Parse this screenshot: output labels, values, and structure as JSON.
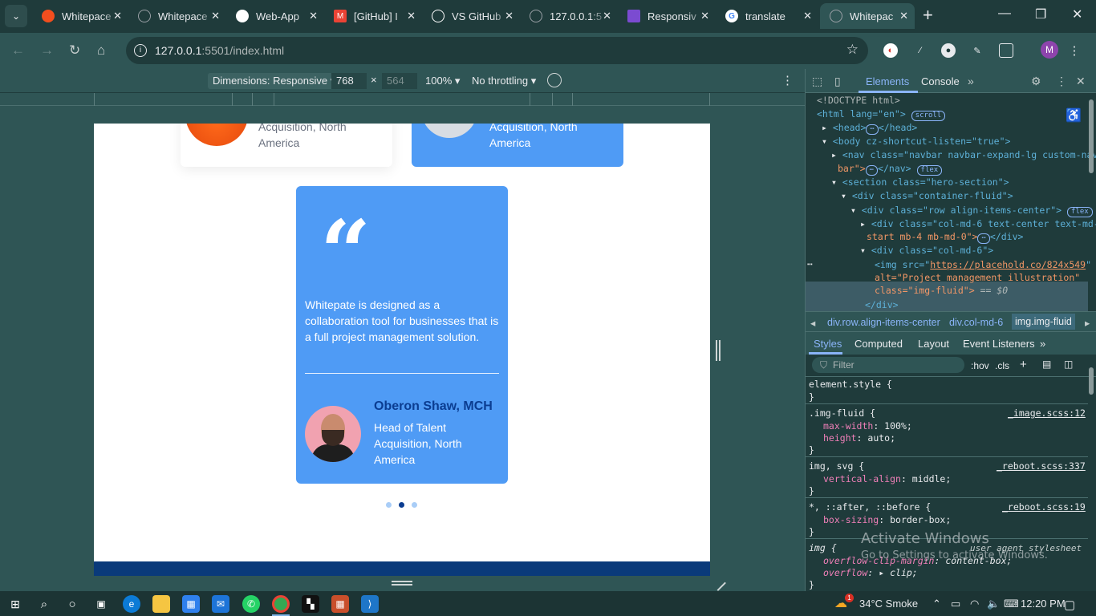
{
  "browser": {
    "tabs": [
      {
        "title": "Whitepace",
        "favicon": "figma-icon",
        "color": "#f24e1e"
      },
      {
        "title": "Whitepace",
        "favicon": "globe-icon",
        "color": "#9aa0a6"
      },
      {
        "title": "Web-App",
        "favicon": "github-icon",
        "color": "#ffffff"
      },
      {
        "title": "[GitHub] I",
        "favicon": "gmail-icon",
        "color": "#ea4335"
      },
      {
        "title": "VS GitHub",
        "favicon": "openai-icon",
        "color": "#ffffff"
      },
      {
        "title": "127.0.0.1:5",
        "favicon": "globe-icon",
        "color": "#9aa0a6"
      },
      {
        "title": "Responsiv",
        "favicon": "forms-icon",
        "color": "#7b4bd1"
      },
      {
        "title": "translate",
        "favicon": "google-icon",
        "color": "#4285f4"
      },
      {
        "title": "Whitepac",
        "favicon": "globe-icon",
        "color": "#9aa0a6",
        "active": true
      }
    ],
    "url_host": "127.0.0.1",
    "url_path": ":5501/index.html",
    "profile_initial": "M"
  },
  "device_toolbar": {
    "dimensions_label": "Dimensions: Responsive",
    "width": "768",
    "times": "×",
    "height": "564",
    "zoom": "100%",
    "throttling": "No throttling"
  },
  "page": {
    "card_top_left": {
      "role": "Acquisition, North America"
    },
    "card_top_right": {
      "role": "Acquisition, North America"
    },
    "testimonial": {
      "quote": "Whitepate is designed as a collaboration tool for businesses that is a full project management solution.",
      "name": "Oberon Shaw, MCH",
      "role": "Head of Talent Acquisition, North America"
    },
    "carousel_dots": 3,
    "active_dot": 1
  },
  "devtools": {
    "tabs": [
      "Elements",
      "Console"
    ],
    "active_tab": "Elements",
    "dom": {
      "doctype": "<!DOCTYPE html>",
      "html_open": "<html lang=\"en\">",
      "html_badge": "scroll",
      "head": "<head>",
      "head_close": "</head>",
      "body_open": "<body cz-shortcut-listen=\"true\">",
      "nav_line1": "<nav class=\"navbar navbar-expand-lg custom-nav",
      "nav_line2": "bar\">",
      "nav_close": "</nav>",
      "flex_badge": "flex",
      "section": "<section class=\"hero-section\">",
      "container": "<div class=\"container-fluid\">",
      "row": "<div class=\"row align-items-center\">",
      "col1_line1": "<div class=\"col-md-6 text-center text-md-",
      "col1_line2": "start mb-4 mb-md-0\">",
      "div_close": "</div>",
      "col2": "<div class=\"col-md-6\">",
      "img_src_label": "<img src=\"",
      "img_src": "https://placehold.co/824x549",
      "img_alt": "alt=\"Project management illustration\"",
      "img_class": "class=\"img-fluid\">",
      "img_eq": "== $0",
      "close_div": "</div>"
    },
    "breadcrumbs": [
      "div.row.align-items-center",
      "div.col-md-6",
      "img.img-fluid"
    ],
    "style_tabs": [
      "Styles",
      "Computed",
      "Layout",
      "Event Listeners"
    ],
    "filter_placeholder": "Filter",
    "hov": ":hov",
    "cls": ".cls",
    "rules": {
      "element_style": "element.style {",
      "brace_close": "}",
      "img_fluid_sel": ".img-fluid {",
      "img_fluid_src": "_image.scss:12",
      "max_width_prop": "max-width",
      "max_width_val": "100%;",
      "height_prop": "height",
      "height_val": "auto;",
      "img_svg_sel": "img, svg {",
      "img_svg_src": "_reboot.scss:337",
      "valign_prop": "vertical-align",
      "valign_val": "middle;",
      "universal_sel": "*, ::after, ::before {",
      "universal_src": "_reboot.scss:19",
      "boxsizing_prop": "box-sizing",
      "boxsizing_val": "border-box;",
      "img_sel": "img {",
      "img_src_note": "user agent stylesheet",
      "overflow_clip_prop": "overflow-clip-margin",
      "overflow_clip_val": "content-box;",
      "overflow_prop": "overflow",
      "overflow_val": "clip;"
    },
    "watermark_title": "Activate Windows",
    "watermark_sub": "Go to Settings to activate Windows."
  },
  "taskbar": {
    "weather": "34°C  Smoke",
    "time": "12:20 PM",
    "notif_count": "1"
  }
}
